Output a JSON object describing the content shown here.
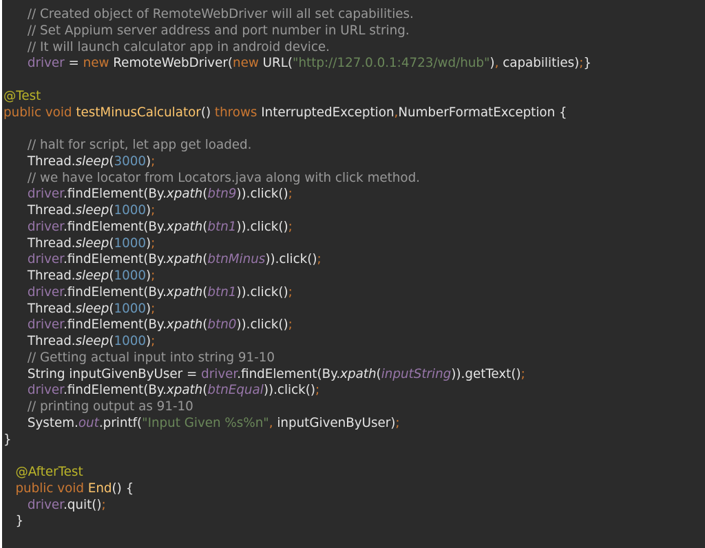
{
  "editor": {
    "lines": [
      [
        {
          "t": "      ",
          "c": "c-txt"
        },
        {
          "t": "// Created object of RemoteWebDriver will all set capabilities.",
          "c": "c-com"
        }
      ],
      [
        {
          "t": "      ",
          "c": "c-txt"
        },
        {
          "t": "// Set Appium server address and port number in URL string.",
          "c": "c-com"
        }
      ],
      [
        {
          "t": "      ",
          "c": "c-txt"
        },
        {
          "t": "// It will launch calculator app in android device.",
          "c": "c-com"
        }
      ],
      [
        {
          "t": "      ",
          "c": "c-txt"
        },
        {
          "t": "driver",
          "c": "c-var"
        },
        {
          "t": " = ",
          "c": "c-txt"
        },
        {
          "t": "new",
          "c": "c-kw"
        },
        {
          "t": " RemoteWebDriver(",
          "c": "c-txt"
        },
        {
          "t": "new",
          "c": "c-kw"
        },
        {
          "t": " URL(",
          "c": "c-txt"
        },
        {
          "t": "\"http://127.0.0.1:4723/wd/hub\"",
          "c": "c-str"
        },
        {
          "t": ")",
          "c": "c-txt"
        },
        {
          "t": ", ",
          "c": "c-semi"
        },
        {
          "t": "capabilities)",
          "c": "c-txt"
        },
        {
          "t": ";",
          "c": "c-semi"
        },
        {
          "t": "}",
          "c": "c-txt"
        }
      ],
      [],
      [
        {
          "t": "@Test",
          "c": "c-ann"
        }
      ],
      [
        {
          "t": "public void ",
          "c": "c-kw"
        },
        {
          "t": "testMinusCalculator",
          "c": "c-fn"
        },
        {
          "t": "() ",
          "c": "c-txt"
        },
        {
          "t": "throws ",
          "c": "c-kw"
        },
        {
          "t": "InterruptedException",
          "c": "c-txt"
        },
        {
          "t": ",",
          "c": "c-semi"
        },
        {
          "t": "NumberFormatException {",
          "c": "c-txt"
        }
      ],
      [],
      [
        {
          "t": "      ",
          "c": "c-txt"
        },
        {
          "t": "// halt for script, let app get loaded.",
          "c": "c-com"
        }
      ],
      [
        {
          "t": "      ",
          "c": "c-txt"
        },
        {
          "t": "Thread.",
          "c": "c-txt"
        },
        {
          "t": "sleep",
          "c": "c-txt c-it"
        },
        {
          "t": "(",
          "c": "c-txt"
        },
        {
          "t": "3000",
          "c": "c-num"
        },
        {
          "t": ")",
          "c": "c-txt"
        },
        {
          "t": ";",
          "c": "c-semi"
        }
      ],
      [
        {
          "t": "      ",
          "c": "c-txt"
        },
        {
          "t": "// we have locator from Locators.java along with click method.",
          "c": "c-com"
        }
      ],
      [
        {
          "t": "      ",
          "c": "c-txt"
        },
        {
          "t": "driver",
          "c": "c-var"
        },
        {
          "t": ".findElement(By.",
          "c": "c-txt"
        },
        {
          "t": "xpath",
          "c": "c-txt c-it"
        },
        {
          "t": "(",
          "c": "c-txt"
        },
        {
          "t": "btn9",
          "c": "c-var c-it"
        },
        {
          "t": ")).click()",
          "c": "c-txt"
        },
        {
          "t": ";",
          "c": "c-semi"
        }
      ],
      [
        {
          "t": "      ",
          "c": "c-txt"
        },
        {
          "t": "Thread.",
          "c": "c-txt"
        },
        {
          "t": "sleep",
          "c": "c-txt c-it"
        },
        {
          "t": "(",
          "c": "c-txt"
        },
        {
          "t": "1000",
          "c": "c-num"
        },
        {
          "t": ")",
          "c": "c-txt"
        },
        {
          "t": ";",
          "c": "c-semi"
        }
      ],
      [
        {
          "t": "      ",
          "c": "c-txt"
        },
        {
          "t": "driver",
          "c": "c-var"
        },
        {
          "t": ".findElement(By.",
          "c": "c-txt"
        },
        {
          "t": "xpath",
          "c": "c-txt c-it"
        },
        {
          "t": "(",
          "c": "c-txt"
        },
        {
          "t": "btn1",
          "c": "c-var c-it"
        },
        {
          "t": ")).click()",
          "c": "c-txt"
        },
        {
          "t": ";",
          "c": "c-semi"
        }
      ],
      [
        {
          "t": "      ",
          "c": "c-txt"
        },
        {
          "t": "Thread.",
          "c": "c-txt"
        },
        {
          "t": "sleep",
          "c": "c-txt c-it"
        },
        {
          "t": "(",
          "c": "c-txt"
        },
        {
          "t": "1000",
          "c": "c-num"
        },
        {
          "t": ")",
          "c": "c-txt"
        },
        {
          "t": ";",
          "c": "c-semi"
        }
      ],
      [
        {
          "t": "      ",
          "c": "c-txt"
        },
        {
          "t": "driver",
          "c": "c-var"
        },
        {
          "t": ".findElement(By.",
          "c": "c-txt"
        },
        {
          "t": "xpath",
          "c": "c-txt c-it"
        },
        {
          "t": "(",
          "c": "c-txt"
        },
        {
          "t": "btnMinus",
          "c": "c-var c-it"
        },
        {
          "t": ")).click()",
          "c": "c-txt"
        },
        {
          "t": ";",
          "c": "c-semi"
        }
      ],
      [
        {
          "t": "      ",
          "c": "c-txt"
        },
        {
          "t": "Thread.",
          "c": "c-txt"
        },
        {
          "t": "sleep",
          "c": "c-txt c-it"
        },
        {
          "t": "(",
          "c": "c-txt"
        },
        {
          "t": "1000",
          "c": "c-num"
        },
        {
          "t": ")",
          "c": "c-txt"
        },
        {
          "t": ";",
          "c": "c-semi"
        }
      ],
      [
        {
          "t": "      ",
          "c": "c-txt"
        },
        {
          "t": "driver",
          "c": "c-var"
        },
        {
          "t": ".findElement(By.",
          "c": "c-txt"
        },
        {
          "t": "xpath",
          "c": "c-txt c-it"
        },
        {
          "t": "(",
          "c": "c-txt"
        },
        {
          "t": "btn1",
          "c": "c-var c-it"
        },
        {
          "t": ")).click()",
          "c": "c-txt"
        },
        {
          "t": ";",
          "c": "c-semi"
        }
      ],
      [
        {
          "t": "      ",
          "c": "c-txt"
        },
        {
          "t": "Thread.",
          "c": "c-txt"
        },
        {
          "t": "sleep",
          "c": "c-txt c-it"
        },
        {
          "t": "(",
          "c": "c-txt"
        },
        {
          "t": "1000",
          "c": "c-num"
        },
        {
          "t": ")",
          "c": "c-txt"
        },
        {
          "t": ";",
          "c": "c-semi"
        }
      ],
      [
        {
          "t": "      ",
          "c": "c-txt"
        },
        {
          "t": "driver",
          "c": "c-var"
        },
        {
          "t": ".findElement(By.",
          "c": "c-txt"
        },
        {
          "t": "xpath",
          "c": "c-txt c-it"
        },
        {
          "t": "(",
          "c": "c-txt"
        },
        {
          "t": "btn0",
          "c": "c-var c-it"
        },
        {
          "t": ")).click()",
          "c": "c-txt"
        },
        {
          "t": ";",
          "c": "c-semi"
        }
      ],
      [
        {
          "t": "      ",
          "c": "c-txt"
        },
        {
          "t": "Thread.",
          "c": "c-txt"
        },
        {
          "t": "sleep",
          "c": "c-txt c-it"
        },
        {
          "t": "(",
          "c": "c-txt"
        },
        {
          "t": "1000",
          "c": "c-num"
        },
        {
          "t": ")",
          "c": "c-txt"
        },
        {
          "t": ";",
          "c": "c-semi"
        }
      ],
      [
        {
          "t": "      ",
          "c": "c-txt"
        },
        {
          "t": "// Getting actual input into string 91-10",
          "c": "c-com"
        }
      ],
      [
        {
          "t": "      ",
          "c": "c-txt"
        },
        {
          "t": "String inputGivenByUser = ",
          "c": "c-txt"
        },
        {
          "t": "driver",
          "c": "c-var"
        },
        {
          "t": ".findElement(By.",
          "c": "c-txt"
        },
        {
          "t": "xpath",
          "c": "c-txt c-it"
        },
        {
          "t": "(",
          "c": "c-txt"
        },
        {
          "t": "inputString",
          "c": "c-var c-it"
        },
        {
          "t": ")).getText()",
          "c": "c-txt"
        },
        {
          "t": ";",
          "c": "c-semi"
        }
      ],
      [
        {
          "t": "      ",
          "c": "c-txt"
        },
        {
          "t": "driver",
          "c": "c-var"
        },
        {
          "t": ".findElement(By.",
          "c": "c-txt"
        },
        {
          "t": "xpath",
          "c": "c-txt c-it"
        },
        {
          "t": "(",
          "c": "c-txt"
        },
        {
          "t": "btnEqual",
          "c": "c-var c-it"
        },
        {
          "t": ")).click()",
          "c": "c-txt"
        },
        {
          "t": ";",
          "c": "c-semi"
        }
      ],
      [
        {
          "t": "      ",
          "c": "c-txt"
        },
        {
          "t": "// printing output as 91-10",
          "c": "c-com"
        }
      ],
      [
        {
          "t": "      ",
          "c": "c-txt"
        },
        {
          "t": "System.",
          "c": "c-txt"
        },
        {
          "t": "out",
          "c": "c-var c-it"
        },
        {
          "t": ".printf(",
          "c": "c-txt"
        },
        {
          "t": "\"Input Given %s%n\"",
          "c": "c-str"
        },
        {
          "t": ", ",
          "c": "c-semi"
        },
        {
          "t": "inputGivenByUser)",
          "c": "c-txt"
        },
        {
          "t": ";",
          "c": "c-semi"
        }
      ],
      [
        {
          "t": "}",
          "c": "c-txt"
        }
      ],
      [],
      [
        {
          "t": "   ",
          "c": "c-txt"
        },
        {
          "t": "@AfterTest",
          "c": "c-ann"
        }
      ],
      [
        {
          "t": "   ",
          "c": "c-txt"
        },
        {
          "t": "public void ",
          "c": "c-kw"
        },
        {
          "t": "End",
          "c": "c-fn"
        },
        {
          "t": "() {",
          "c": "c-txt"
        }
      ],
      [
        {
          "t": "      ",
          "c": "c-txt"
        },
        {
          "t": "driver",
          "c": "c-var"
        },
        {
          "t": ".quit()",
          "c": "c-txt"
        },
        {
          "t": ";",
          "c": "c-semi"
        }
      ],
      [
        {
          "t": "   ",
          "c": "c-txt"
        },
        {
          "t": "}",
          "c": "c-txt"
        }
      ]
    ]
  }
}
